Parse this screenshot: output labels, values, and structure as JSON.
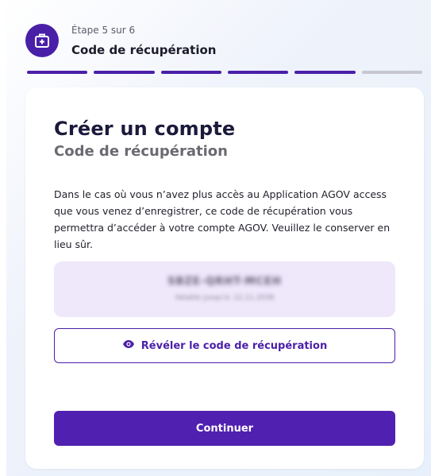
{
  "header": {
    "step_label": "Étape 5 sur 6",
    "step_title": "Code de récupération",
    "icon": "medical-kit-icon"
  },
  "progress": {
    "total_steps": 6,
    "completed_steps": 5
  },
  "card": {
    "title": "Créer un compte",
    "subtitle": "Code de récupération",
    "description": "Dans le cas où vous n’avez plus accès au Application AGOV access que vous venez d’enregistrer, ce code de récupération vous permettra d’accéder à votre compte AGOV. Veuillez le conserver en lieu sûr.",
    "recovery_code": "SBZE-QRHT-MCEH",
    "recovery_code_note": "Valable jusqu'à: 12.11.2036",
    "reveal_label": "Révéler le code de récupération",
    "reveal_icon": "eye-icon",
    "continue_label": "Continuer"
  },
  "colors": {
    "primary": "#4a1fa8",
    "code_background": "#efe8fb",
    "inactive": "#c7c7cf"
  }
}
